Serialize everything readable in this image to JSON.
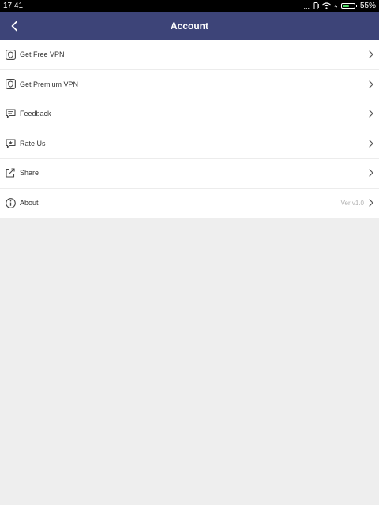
{
  "status_bar": {
    "time": "17:41",
    "dots": "...",
    "battery_percent": "55%",
    "battery_level": 0.55
  },
  "header": {
    "title": "Account",
    "color": "#3d4478"
  },
  "menu": {
    "items": [
      {
        "label": "Get Free VPN",
        "icon": "vpn-shield-icon"
      },
      {
        "label": "Get Premium VPN",
        "icon": "vpn-shield-icon"
      },
      {
        "label": "Feedback",
        "icon": "message-icon"
      },
      {
        "label": "Rate Us",
        "icon": "rate-star-icon"
      },
      {
        "label": "Share",
        "icon": "share-icon"
      },
      {
        "label": "About",
        "icon": "info-icon",
        "value": "Ver v1.0"
      }
    ]
  }
}
